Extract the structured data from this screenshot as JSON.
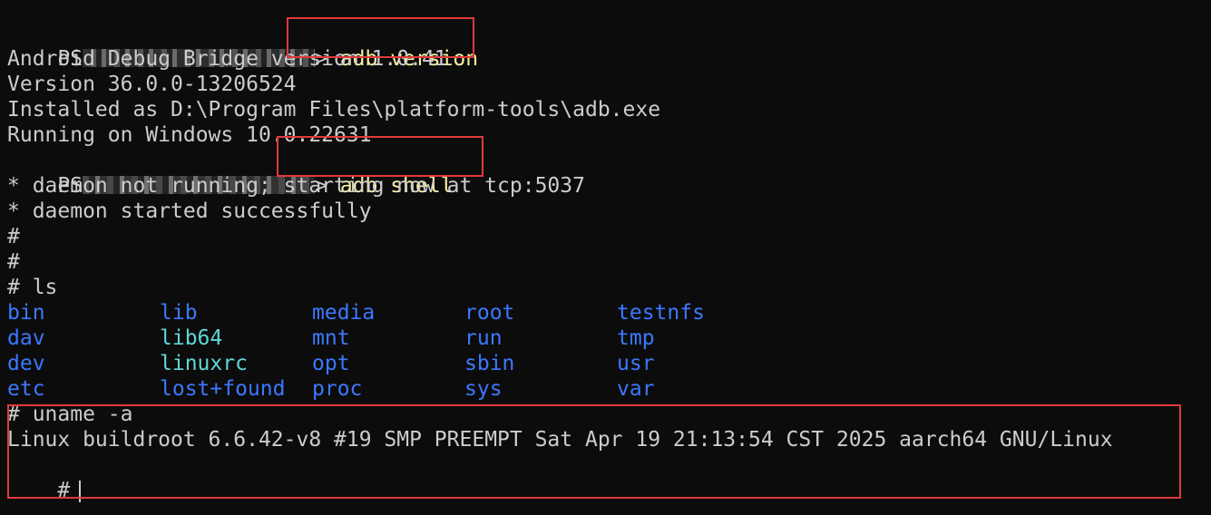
{
  "colors": {
    "background": "#0c0c0c",
    "text": "#cccccc",
    "command": "#f9f1a5",
    "directory": "#3b78ff",
    "symlink": "#61d6d6",
    "highlight_box": "#e03a3a"
  },
  "prompts": {
    "ps": "PS",
    "arrow": ">",
    "root": "#"
  },
  "lines": {
    "cmd_adb_version": "adb version",
    "adb_version": "Android Debug Bridge version 1.0.41",
    "version": "Version 36.0.0-13206524",
    "installed": "Installed as D:\\Program Files\\platform-tools\\adb.exe",
    "running": "Running on Windows 10.0.22631",
    "cmd_adb_shell": "adb shell",
    "daemon_starting": "* daemon not running; starting now at tcp:5037",
    "daemon_started": "* daemon started successfully",
    "empty_prompt_1": "#",
    "empty_prompt_2": "#",
    "ls_cmd": "# ls",
    "uname_cmd": "# uname -a",
    "uname_output": "Linux buildroot 6.6.42-v8 #19 SMP PREEMPT Sat Apr 19 21:13:54 CST 2025 aarch64 GNU/Linux",
    "final_prompt": "#"
  },
  "ls_rows": [
    [
      "bin",
      "lib",
      "media",
      "root",
      "testnfs"
    ],
    [
      "dav",
      "lib64",
      "mnt",
      "run",
      "tmp"
    ],
    [
      "dev",
      "linuxrc",
      "opt",
      "sbin",
      "usr"
    ],
    [
      "etc",
      "lost+found",
      "proc",
      "sys",
      "var"
    ]
  ]
}
